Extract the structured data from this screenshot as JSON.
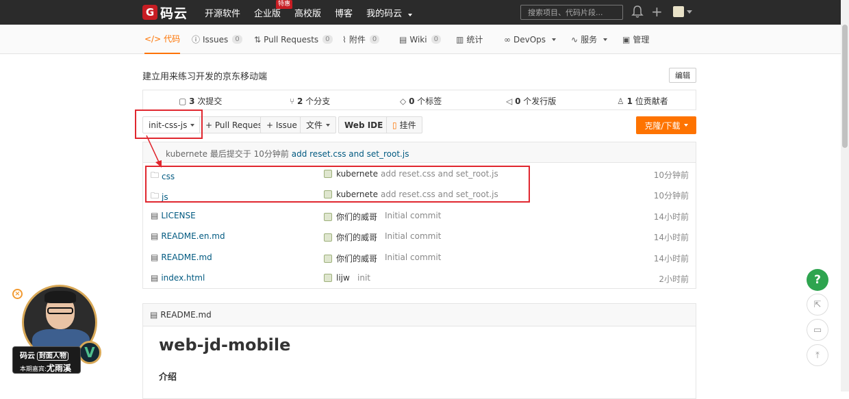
{
  "topbar": {
    "logo_mark": "G",
    "logo_text": "码云",
    "nav": [
      "开源软件",
      "企业版",
      "高校版",
      "博客",
      "我的码云"
    ],
    "hot_badge": "特惠",
    "search_placeholder": "搜索项目、代码片段..."
  },
  "tabs": [
    {
      "label": "代码",
      "icon": "code-icon"
    },
    {
      "label": "Issues",
      "count": "0",
      "icon": "issue-icon"
    },
    {
      "label": "Pull Requests",
      "count": "0",
      "icon": "pull-request-icon"
    },
    {
      "label": "附件",
      "count": "0",
      "icon": "paperclip-icon"
    },
    {
      "label": "Wiki",
      "count": "0",
      "icon": "book-icon"
    },
    {
      "label": "统计",
      "icon": "bar-chart-icon"
    },
    {
      "label": "DevOps",
      "icon": "infinity-icon"
    },
    {
      "label": "服务",
      "icon": "pulse-icon"
    },
    {
      "label": "管理",
      "icon": "settings-doc-icon"
    }
  ],
  "repo": {
    "description": "建立用来练习开发的京东移动端",
    "edit_label": "编辑"
  },
  "stats": [
    {
      "num": "3",
      "label": "次提交",
      "icon": "commit-icon"
    },
    {
      "num": "2",
      "label": "个分支",
      "icon": "branch-icon"
    },
    {
      "num": "0",
      "label": "个标签",
      "icon": "tag-icon"
    },
    {
      "num": "0",
      "label": "个发行版",
      "icon": "release-icon"
    },
    {
      "num": "1",
      "label": "位贡献者",
      "icon": "contributors-icon"
    }
  ],
  "toolbar": {
    "branch": "init-css-js",
    "pull_request": "+ Pull Request",
    "issue": "+ Issue",
    "file": "文件",
    "web_ide": "Web IDE",
    "widget": "挂件",
    "clone": "克隆/下载"
  },
  "last_commit": {
    "author": "kubernete",
    "text": "最后提交于 10分钟前",
    "message": "add reset.css and set_root.js"
  },
  "files": [
    {
      "name": "css",
      "type": "folder",
      "author": "kubernete",
      "message": "add reset.css and set_root.js",
      "time": "10分钟前"
    },
    {
      "name": "js",
      "type": "folder",
      "author": "kubernete",
      "message": "add reset.css and set_root.js",
      "time": "10分钟前"
    },
    {
      "name": "LICENSE",
      "type": "file",
      "author": "你们的威哥",
      "message": "Initial commit",
      "time": "14小时前"
    },
    {
      "name": "README.en.md",
      "type": "file",
      "author": "你们的威哥",
      "message": "Initial commit",
      "time": "14小时前"
    },
    {
      "name": "README.md",
      "type": "file",
      "author": "你们的威哥",
      "message": "Initial commit",
      "time": "14小时前"
    },
    {
      "name": "index.html",
      "type": "file",
      "author": "lijw",
      "message": "init",
      "time": "2小时前"
    }
  ],
  "readme": {
    "file": "README.md",
    "title": "web-jd-mobile",
    "section": "介绍"
  },
  "fabs": {
    "help": "?"
  },
  "live": {
    "brand": "码云",
    "tag": "封面人物",
    "guest_prefix": "本期嘉宾:",
    "guest_name": "尤雨溪",
    "logo": "V"
  },
  "colors": {
    "accent": "#fe7300",
    "topbar": "#2b2b2b",
    "link": "#005980",
    "highlight": "#e0262e",
    "help": "#2ea44f"
  }
}
